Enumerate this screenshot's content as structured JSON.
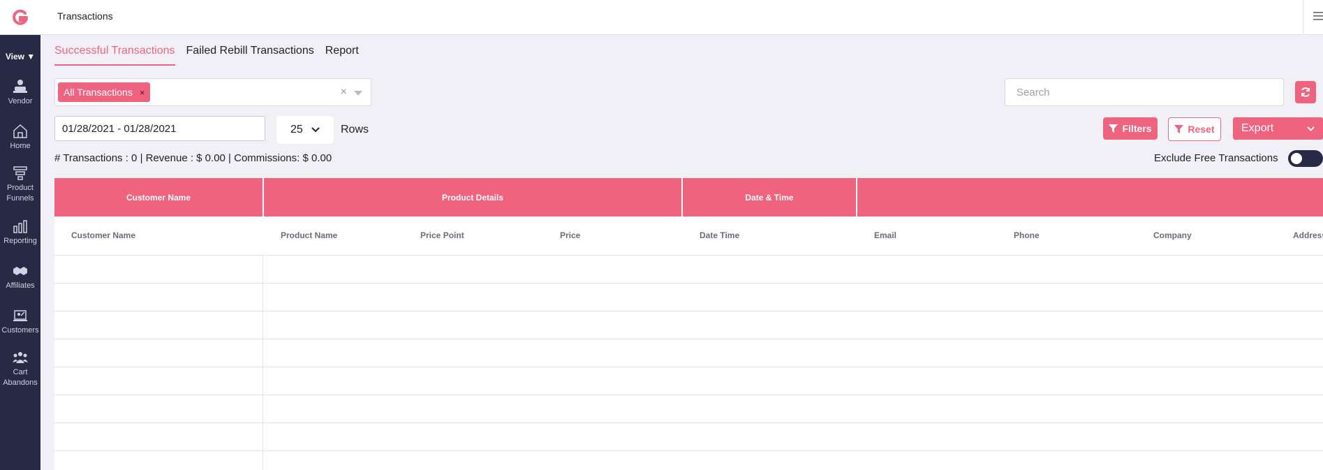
{
  "topbar": {
    "title": "Transactions"
  },
  "sidebar": {
    "view_label": "View ▼",
    "items": [
      {
        "label": "Vendor"
      },
      {
        "label": "Home"
      },
      {
        "label": "Product Funnels"
      },
      {
        "label": "Reporting"
      },
      {
        "label": "Affiliates"
      },
      {
        "label": "Customers"
      },
      {
        "label": "Cart Abandons"
      }
    ]
  },
  "tabs": [
    {
      "label": "Successful Transactions",
      "active": true
    },
    {
      "label": "Failed Rebill Transactions",
      "active": false
    },
    {
      "label": "Report",
      "active": false
    }
  ],
  "filter": {
    "chip_label": "All Transactions",
    "chip_remove": "×",
    "clear": "×"
  },
  "search": {
    "placeholder": "Search",
    "value": ""
  },
  "date_range": {
    "value": "01/28/2021 - 01/28/2021"
  },
  "rows": {
    "selected": "25",
    "label": "Rows"
  },
  "buttons": {
    "filters": "Filters",
    "reset": "Reset",
    "export": "Export"
  },
  "summary": "# Transactions : 0 | Revenue : $ 0.00 | Commissions: $ 0.00",
  "exclude_free": {
    "label": "Exclude Free Transactions",
    "checked": true
  },
  "table": {
    "groups": [
      "Customer Name",
      "Product Details",
      "Date & Time",
      ""
    ],
    "columns": [
      "Customer Name",
      "Product Name",
      "Price Point",
      "Price",
      "Date Time",
      "Email",
      "Phone",
      "Company",
      "Address"
    ]
  },
  "colors": {
    "accent": "#f0637f",
    "sidebar": "#262a45",
    "background": "#f0f0f6"
  }
}
